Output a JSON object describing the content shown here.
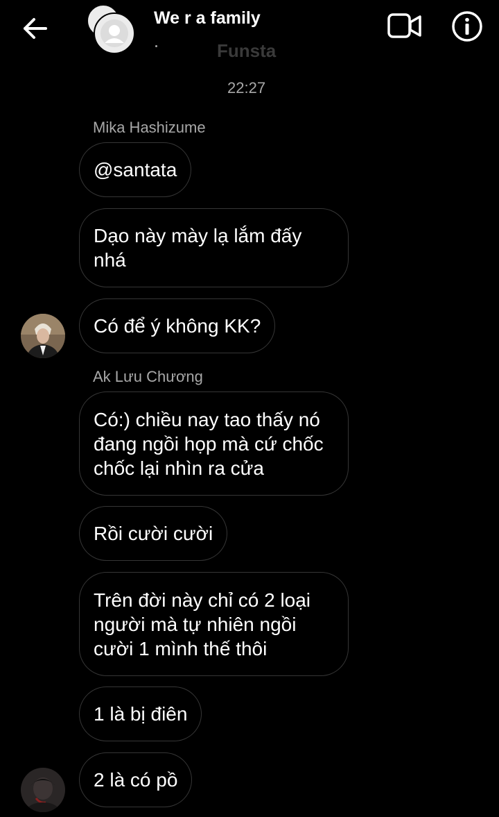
{
  "header": {
    "back_icon": "arrow-left-icon",
    "title": "We r a family",
    "subtitle": "Funsta",
    "video_icon": "video-camera-icon",
    "info_icon": "info-icon"
  },
  "timestamp": "22:27",
  "senders": {
    "first": "Mika Hashizume",
    "second": "Ak Lưu Chương"
  },
  "messages": [
    "@santata",
    "Dạo này mày lạ lắm đấy nhá",
    "Có để ý không KK?",
    "Có:) chiều nay tao thấy nó đang ngồi họp mà cứ chốc chốc lại nhìn ra cửa",
    "Rồi cười cười",
    "Trên đời này chỉ có 2 loại người mà tự nhiên ngồi cười 1 mình thế thôi",
    "1 là bị điên",
    "2 là có pồ"
  ],
  "colors": {
    "background": "#000000",
    "bubble_border": "#363636",
    "muted_text": "#a8a8a8"
  }
}
